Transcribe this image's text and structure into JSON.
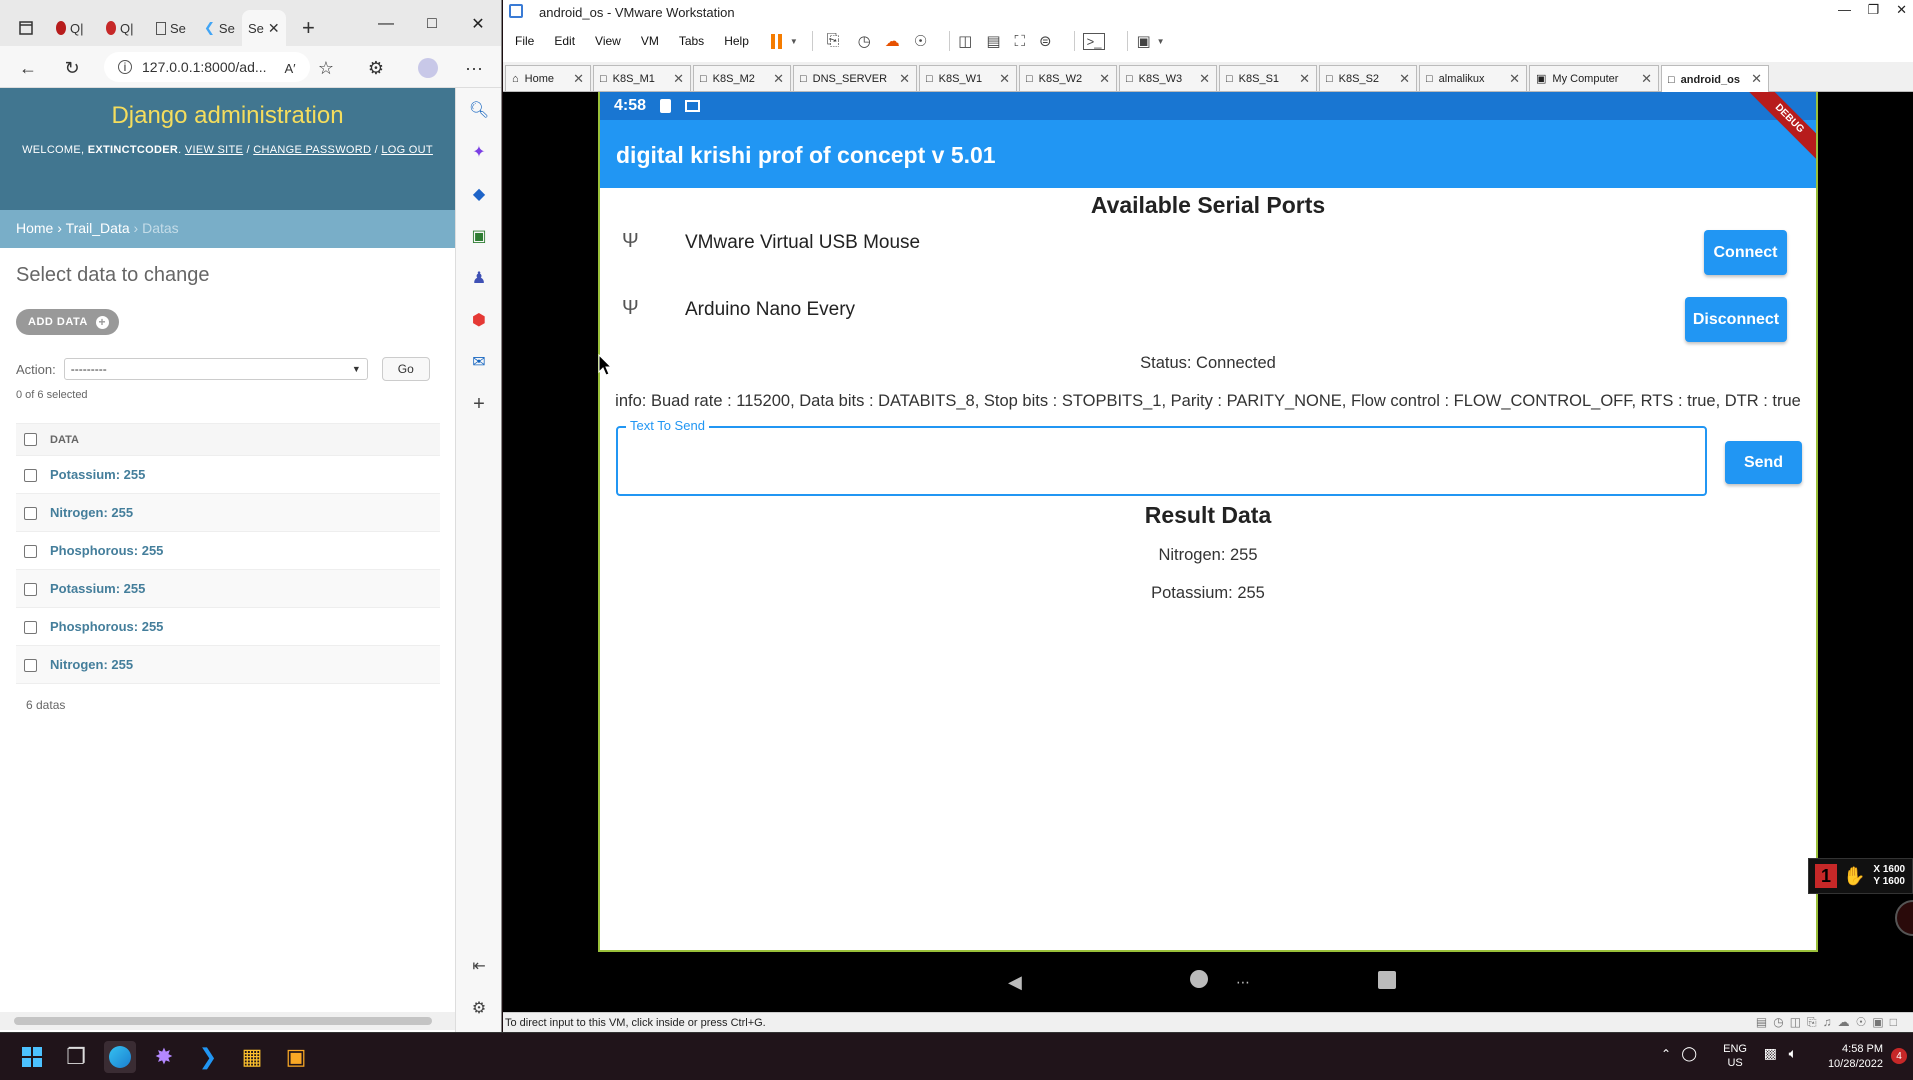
{
  "edge": {
    "tabs": [
      {
        "label": ""
      },
      {
        "label": "Q|"
      },
      {
        "label": "Q|"
      },
      {
        "label": "Se"
      },
      {
        "label": "Se"
      },
      {
        "label": "Se"
      }
    ],
    "address": "127.0.0.1:8000/ad...",
    "read_aloud": "A′",
    "admin": {
      "brand": "Django administration",
      "welcome_prefix": "WELCOME,",
      "username": "EXTINCTCODER",
      "view_site": "VIEW SITE",
      "change_password": "CHANGE PASSWORD",
      "log_out": "LOG OUT",
      "sep": "/",
      "crumbs": {
        "home": "Home",
        "app": "Trail_Data",
        "current": "Datas",
        "sep": "›"
      },
      "title": "Select data to change",
      "add_label": "ADD DATA",
      "action_label": "Action:",
      "action_value": "---------",
      "go_label": "Go",
      "selected_count": "0 of 6 selected",
      "column_header": "DATA",
      "rows": [
        "Potassium: 255",
        "Nitrogen: 255",
        "Phosphorous: 255",
        "Potassium: 255",
        "Phosphorous: 255",
        "Nitrogen: 255"
      ],
      "paginator": "6 datas"
    }
  },
  "vmware": {
    "title": "android_os - VMware Workstation",
    "menu": [
      "File",
      "Edit",
      "View",
      "VM",
      "Tabs",
      "Help"
    ],
    "tabs": [
      "Home",
      "K8S_M1",
      "K8S_M2",
      "DNS_SERVER",
      "K8S_W1",
      "K8S_W2",
      "K8S_W3",
      "K8S_S1",
      "K8S_S2",
      "almalikux",
      "My Computer",
      "android_os"
    ],
    "status_hint": "To direct input to this VM, click inside or press Ctrl+G.",
    "overlay": {
      "x": "X 1600",
      "y": "Y 1600",
      "badge": "1"
    }
  },
  "android": {
    "time": "4:58",
    "debug_banner": "DEBUG",
    "app_title": "digital krishi prof of concept v 5.01",
    "ports_heading": "Available Serial Ports",
    "ports": [
      {
        "name": "VMware Virtual USB Mouse",
        "button": "Connect"
      },
      {
        "name": "Arduino Nano Every",
        "button": "Disconnect"
      }
    ],
    "status": "Status: Connected",
    "info": "info: Buad rate : 115200, Data bits : DATABITS_8, Stop bits : STOPBITS_1, Parity : PARITY_NONE, Flow control : FLOW_CONTROL_OFF, RTS : true, DTR : true",
    "input_label": "Text To Send",
    "input_value": "",
    "send_label": "Send",
    "result_heading": "Result Data",
    "results": [
      "Nitrogen: 255",
      "Potassium: 255"
    ]
  },
  "taskbar": {
    "lang": "ENG",
    "region": "US",
    "time": "4:58 PM",
    "date": "10/28/2022",
    "notification_count": "4"
  }
}
